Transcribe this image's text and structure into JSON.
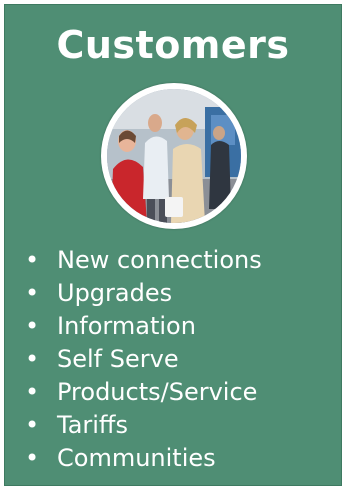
{
  "card": {
    "title": "Customers",
    "background_color": "#4f8e74",
    "photo_icon": "people-photo-icon",
    "items": [
      {
        "label": "New connections",
        "bullet": "•"
      },
      {
        "label": "Upgrades",
        "bullet": "•"
      },
      {
        "label": "Information",
        "bullet": "•"
      },
      {
        "label": "Self Serve",
        "bullet": "•"
      },
      {
        "label": "Products/Service",
        "bullet": "•"
      },
      {
        "label": "Tariffs",
        "bullet": "•"
      },
      {
        "label": "Communities",
        "bullet": "•"
      }
    ]
  }
}
